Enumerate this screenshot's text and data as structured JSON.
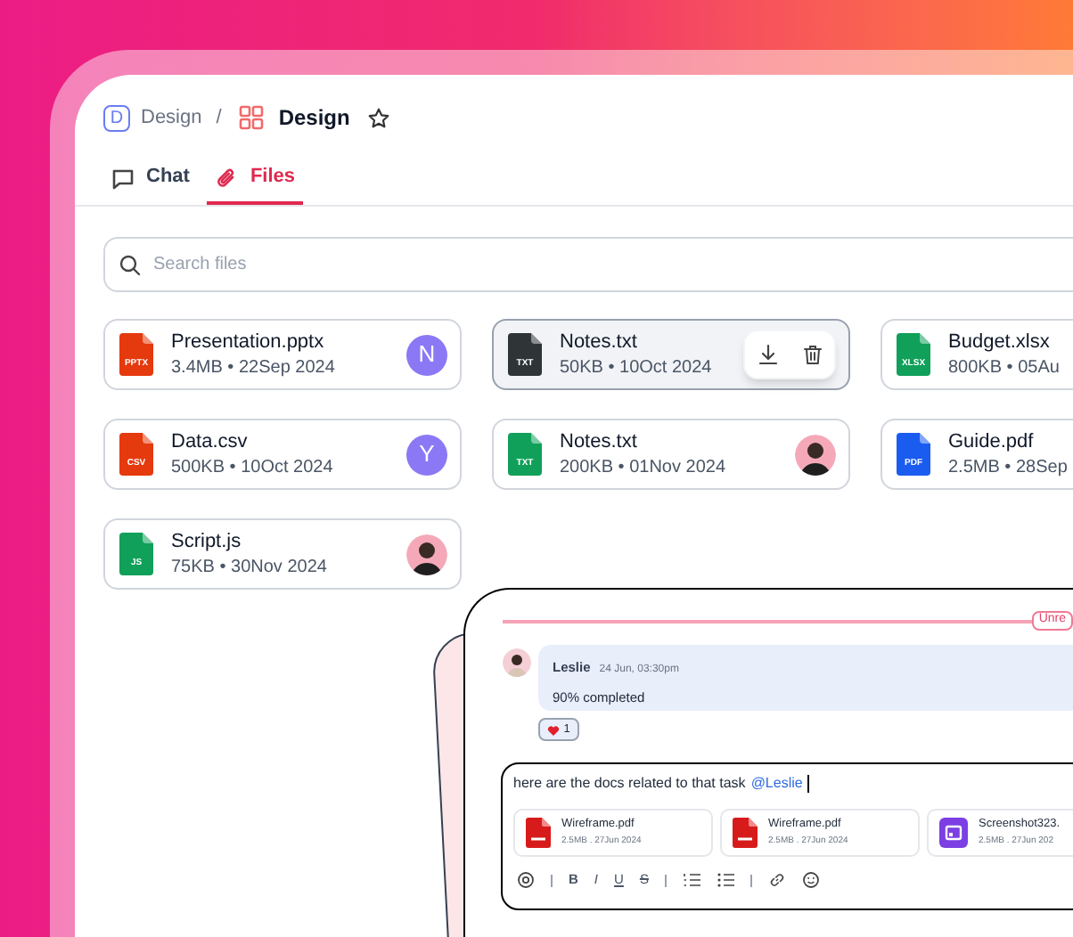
{
  "breadcrumb": {
    "workspace_initial": "D",
    "workspace": "Design",
    "separator": "/",
    "page": "Design",
    "starred": false
  },
  "tabs": [
    {
      "label": "Chat",
      "selected": false
    },
    {
      "label": "Files",
      "selected": true
    }
  ],
  "search": {
    "placeholder": "Search files"
  },
  "files": [
    {
      "name": "Presentation.pptx",
      "meta": "3.4MB • 22Sep 2024",
      "type": "PPTX",
      "color": "#e5390e",
      "owner": {
        "kind": "letter",
        "initial": "N"
      },
      "hovered": false
    },
    {
      "name": "Notes.txt",
      "meta": "50KB • 10Oct 2024",
      "type": "TXT",
      "color": "#2f3437",
      "owner": {
        "kind": "none"
      },
      "hovered": true
    },
    {
      "name": "Budget.xlsx",
      "meta": "800KB • 05Au",
      "type": "XLSX",
      "color": "#10a05a",
      "owner": {
        "kind": "none"
      },
      "hovered": false
    },
    {
      "name": "Data.csv",
      "meta": "500KB • 10Oct 2024",
      "type": "CSV",
      "color": "#e5390e",
      "owner": {
        "kind": "letter",
        "initial": "Y"
      },
      "hovered": false
    },
    {
      "name": "Notes.txt",
      "meta": "200KB • 01Nov 2024",
      "type": "TXT",
      "color": "#10a05a",
      "owner": {
        "kind": "photo"
      },
      "hovered": false
    },
    {
      "name": "Guide.pdf",
      "meta": "2.5MB • 28Sep",
      "type": "PDF",
      "color": "#1a5cf0",
      "owner": {
        "kind": "none"
      },
      "hovered": false
    },
    {
      "name": "Script.js",
      "meta": "75KB • 30Nov 2024",
      "type": "JS",
      "color": "#10a05a",
      "owner": {
        "kind": "photo"
      },
      "hovered": false
    }
  ],
  "chat": {
    "unread_label": "Unre",
    "message": {
      "author": "Leslie",
      "time": "24 Jun, 03:30pm",
      "text": "90% completed",
      "reaction": {
        "count": "1"
      }
    },
    "composer": {
      "text": "here are the docs related to that task",
      "mention": "@Leslie",
      "attachments": [
        {
          "name": "Wireframe.pdf",
          "meta": "2.5MB . 27Jun 2024",
          "kind": "pdf"
        },
        {
          "name": "Wireframe.pdf",
          "meta": "2.5MB . 27Jun 2024",
          "kind": "pdf"
        },
        {
          "name": "Screenshot323.",
          "meta": "2.5MB . 27Jun 202",
          "kind": "image"
        }
      ],
      "toolbar": [
        {
          "kind": "mention"
        },
        {
          "kind": "sep"
        },
        {
          "kind": "bold",
          "label": "B"
        },
        {
          "kind": "italic",
          "label": "I"
        },
        {
          "kind": "underline",
          "label": "U"
        },
        {
          "kind": "strike",
          "label": "S"
        },
        {
          "kind": "sep"
        },
        {
          "kind": "ordered-list"
        },
        {
          "kind": "bullet-list"
        },
        {
          "kind": "sep"
        },
        {
          "kind": "link"
        },
        {
          "kind": "emoji"
        }
      ]
    }
  }
}
